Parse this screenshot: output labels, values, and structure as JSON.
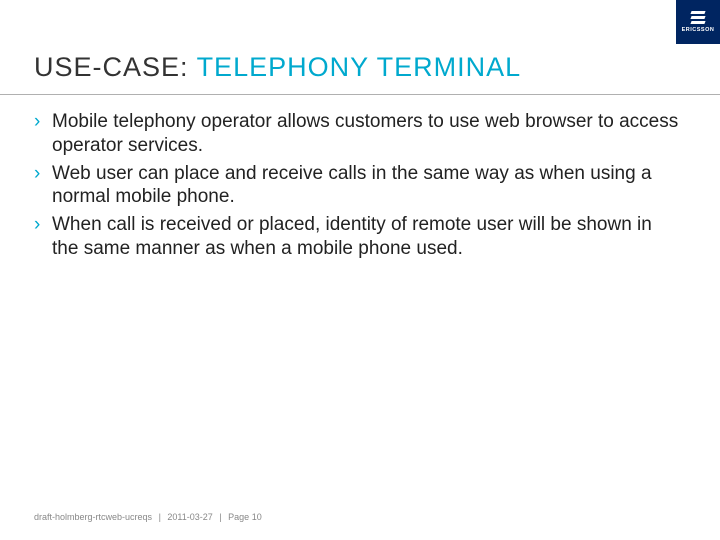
{
  "brand": {
    "name": "ERICSSON"
  },
  "title": {
    "prefix": "USE-CASE: ",
    "accent": "TELEPHONY TERMINAL"
  },
  "bullets": [
    "Mobile telephony operator allows customers to use web browser to access operator services.",
    "Web user can place and receive calls in the same way as when using a normal mobile phone.",
    "When call is received or placed, identity of remote user will be shown in the same manner as when a mobile phone used."
  ],
  "footer": {
    "doc": "draft-holmberg-rtcweb-ucreqs",
    "date": "2011-03-27",
    "page_label": "Page 10",
    "separator": "|"
  },
  "bullet_glyph": "›"
}
